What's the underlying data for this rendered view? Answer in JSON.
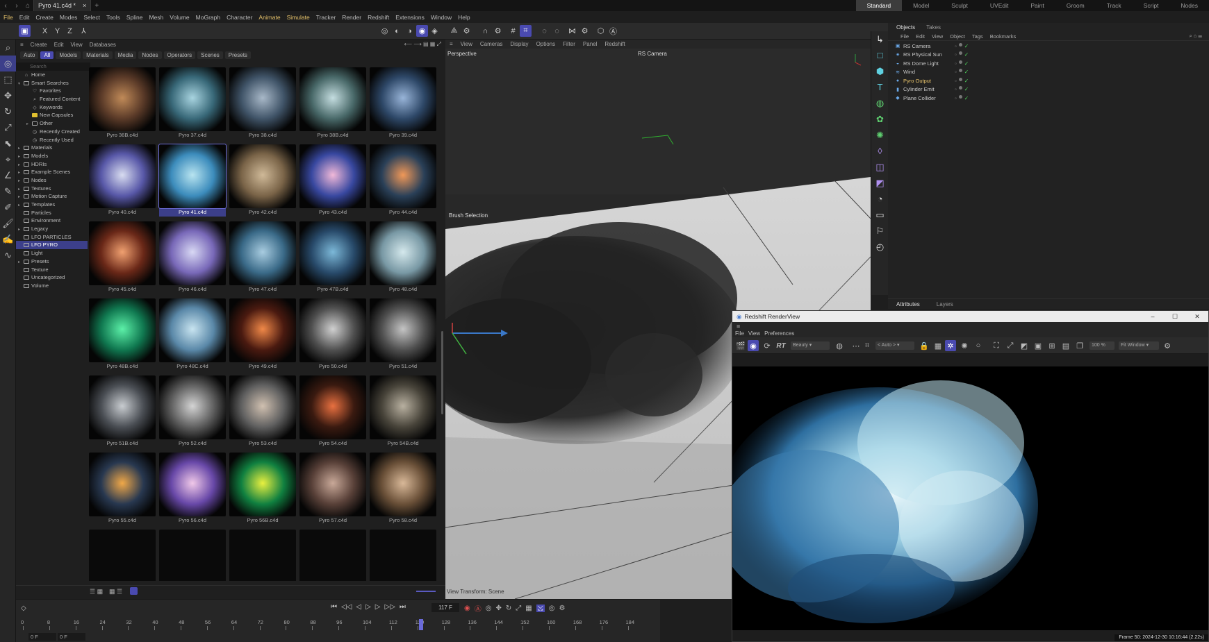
{
  "titlebar": {
    "doc_tab": "Pyro 41.c4d *",
    "close": "×",
    "add": "+",
    "layouts": [
      "Standard",
      "Model",
      "Sculpt",
      "UVEdit",
      "Paint",
      "Groom",
      "Track",
      "Script",
      "Nodes"
    ],
    "active_layout": "Standard"
  },
  "menubar": [
    "File",
    "Edit",
    "Create",
    "Modes",
    "Select",
    "Tools",
    "Spline",
    "Mesh",
    "Volume",
    "MoGraph",
    "Character",
    "Animate",
    "Simulate",
    "Tracker",
    "Render",
    "Redshift",
    "Extensions",
    "Window",
    "Help"
  ],
  "menubar_highlight": [
    "File",
    "Animate",
    "Simulate"
  ],
  "toolbar": {
    "axes": [
      "X",
      "Y",
      "Z"
    ]
  },
  "asset_browser": {
    "menu": [
      "Create",
      "Edit",
      "View",
      "Databases"
    ],
    "filters": [
      "Auto",
      "All",
      "Models",
      "Materials",
      "Media",
      "Nodes",
      "Operators",
      "Scenes",
      "Presets"
    ],
    "active_filter": "All",
    "search_placeholder": "Search",
    "tree": [
      {
        "label": "Home",
        "indent": 0,
        "type": "home"
      },
      {
        "label": "Smart Searches",
        "indent": 0,
        "type": "folder",
        "arrow": "down"
      },
      {
        "label": "Favorites",
        "indent": 1,
        "type": "heart"
      },
      {
        "label": "Featured Content",
        "indent": 1,
        "type": "search"
      },
      {
        "label": "Keywords",
        "indent": 1,
        "type": "tag"
      },
      {
        "label": "New Capsules",
        "indent": 1,
        "type": "yellow"
      },
      {
        "label": "Other",
        "indent": 1,
        "type": "folder",
        "arrow": "right"
      },
      {
        "label": "Recently Created",
        "indent": 1,
        "type": "clock"
      },
      {
        "label": "Recently Used",
        "indent": 1,
        "type": "clock"
      },
      {
        "label": "Materials",
        "indent": 0,
        "type": "folder",
        "arrow": "right"
      },
      {
        "label": "Models",
        "indent": 0,
        "type": "folder",
        "arrow": "right"
      },
      {
        "label": "HDRIs",
        "indent": 0,
        "type": "folder",
        "arrow": "right"
      },
      {
        "label": "Example Scenes",
        "indent": 0,
        "type": "folder",
        "arrow": "right"
      },
      {
        "label": "Nodes",
        "indent": 0,
        "type": "folder",
        "arrow": "right"
      },
      {
        "label": "Textures",
        "indent": 0,
        "type": "folder",
        "arrow": "right"
      },
      {
        "label": "Motion Capture",
        "indent": 0,
        "type": "folder",
        "arrow": "right"
      },
      {
        "label": "Templates",
        "indent": 0,
        "type": "folder",
        "arrow": "right"
      },
      {
        "label": "Particles",
        "indent": 0,
        "type": "folder"
      },
      {
        "label": "Environment",
        "indent": 0,
        "type": "folder"
      },
      {
        "label": "Legacy",
        "indent": 0,
        "type": "folder",
        "arrow": "right"
      },
      {
        "label": "LFO PARTICLES",
        "indent": 0,
        "type": "folder"
      },
      {
        "label": "LFO PYRO",
        "indent": 0,
        "type": "folder",
        "selected": true
      },
      {
        "label": "Light",
        "indent": 0,
        "type": "folder"
      },
      {
        "label": "Presets",
        "indent": 0,
        "type": "folder",
        "arrow": "right"
      },
      {
        "label": "Texture",
        "indent": 0,
        "type": "folder"
      },
      {
        "label": "Uncategorized",
        "indent": 0,
        "type": "folder"
      },
      {
        "label": "Volume",
        "indent": 0,
        "type": "folder"
      }
    ],
    "assets": [
      {
        "label": "Pyro 36B.c4d",
        "c1": "#c08a58",
        "c2": "#5a3a28"
      },
      {
        "label": "Pyro 37.c4d",
        "c1": "#a8d4e0",
        "c2": "#386878"
      },
      {
        "label": "Pyro 38.c4d",
        "c1": "#a8b8c8",
        "c2": "#405468"
      },
      {
        "label": "Pyro 38B.c4d",
        "c1": "#c4dde0",
        "c2": "#486868"
      },
      {
        "label": "Pyro 39.c4d",
        "c1": "#98b4d8",
        "c2": "#2e4868"
      },
      {
        "label": "Pyro 40.c4d",
        "c1": "#d8dcf0",
        "c2": "#5858a8"
      },
      {
        "label": "Pyro 41.c4d",
        "c1": "#b8e4f0",
        "c2": "#3c8cbc"
      },
      {
        "label": "Pyro 42.c4d",
        "c1": "#cfb998",
        "c2": "#7a6448"
      },
      {
        "label": "Pyro 43.c4d",
        "c1": "#f0b8d8",
        "c2": "#3848a0"
      },
      {
        "label": "Pyro 44.c4d",
        "c1": "#f09858",
        "c2": "#2a4058"
      },
      {
        "label": "Pyro 45.c4d",
        "c1": "#f0a070",
        "c2": "#6a2818"
      },
      {
        "label": "Pyro 46.c4d",
        "c1": "#d8d8f4",
        "c2": "#7868b8"
      },
      {
        "label": "Pyro 47.c4d",
        "c1": "#a8cce0",
        "c2": "#3a6a88"
      },
      {
        "label": "Pyro 47B.c4d",
        "c1": "#7cb8d8",
        "c2": "#284a6a"
      },
      {
        "label": "Pyro 48.c4d",
        "c1": "#d4e8ec",
        "c2": "#7898a4"
      },
      {
        "label": "Pyro 48B.c4d",
        "c1": "#5cf0a8",
        "c2": "#107850"
      },
      {
        "label": "Pyro 48C.c4d",
        "c1": "#c8e4f0",
        "c2": "#5a88a8"
      },
      {
        "label": "Pyro 49.c4d",
        "c1": "#f08848",
        "c2": "#4a1a10"
      },
      {
        "label": "Pyro 50.c4d",
        "c1": "#d0d0d0",
        "c2": "#505050"
      },
      {
        "label": "Pyro 51.c4d",
        "c1": "#c4c4c4",
        "c2": "#505050"
      },
      {
        "label": "Pyro 51B.c4d",
        "c1": "#c8ccd0",
        "c2": "#4a4e54"
      },
      {
        "label": "Pyro 52.c4d",
        "c1": "#d4d4d4",
        "c2": "#606060"
      },
      {
        "label": "Pyro 53.c4d",
        "c1": "#d0c0b0",
        "c2": "#606060"
      },
      {
        "label": "Pyro 54.c4d",
        "c1": "#e87040",
        "c2": "#3a1a10"
      },
      {
        "label": "Pyro 54B.c4d",
        "c1": "#b8b0a0",
        "c2": "#48443a"
      },
      {
        "label": "Pyro 55.c4d",
        "c1": "#f0a848",
        "c2": "#283850"
      },
      {
        "label": "Pyro 56.c4d",
        "c1": "#f0c8e8",
        "c2": "#6848a8"
      },
      {
        "label": "Pyro 56B.c4d",
        "c1": "#e8f040",
        "c2": "#108040"
      },
      {
        "label": "Pyro 57.c4d",
        "c1": "#c8a898",
        "c2": "#584038"
      },
      {
        "label": "Pyro 58.c4d",
        "c1": "#d8b898",
        "c2": "#6a5038"
      }
    ]
  },
  "viewport": {
    "menu": [
      "View",
      "Cameras",
      "Display",
      "Options",
      "Filter",
      "Panel",
      "Redshift"
    ],
    "label": "Perspective",
    "camera": "RS Camera",
    "brush_label": "Brush Selection",
    "bottom_label": "View Transform: Scene"
  },
  "timeline": {
    "frame_field": "117 F",
    "start_field": "0 F",
    "end_field": "0 F",
    "ticks": [
      "0",
      "8",
      "16",
      "24",
      "32",
      "40",
      "48",
      "56",
      "64",
      "72",
      "80",
      "88",
      "96",
      "104",
      "112",
      "120",
      "128",
      "136",
      "144",
      "152",
      "160",
      "168",
      "176",
      "184"
    ],
    "playhead_label": "117",
    "frame_fraction": 0.635
  },
  "object_manager": {
    "tabs": [
      "Objects",
      "Takes"
    ],
    "active_tab": "Objects",
    "menu": [
      "File",
      "Edit",
      "View",
      "Object",
      "Tags",
      "Bookmarks"
    ],
    "objects": [
      {
        "name": "RS Camera",
        "icon": "camera-icon",
        "glyph": "▣",
        "color": "#c8c8c8"
      },
      {
        "name": "RS Physical Sun",
        "icon": "sun-icon",
        "glyph": "✷",
        "color": "#c8c8c8"
      },
      {
        "name": "RS Dome Light",
        "icon": "dome-icon",
        "glyph": "◒",
        "color": "#c8c8c8"
      },
      {
        "name": "Wind",
        "icon": "wind-icon",
        "glyph": "≋",
        "color": "#c8c8c8"
      },
      {
        "name": "Pyro Output",
        "icon": "pyro-output-icon",
        "glyph": "●",
        "color": "#e6c26a"
      },
      {
        "name": "Cylinder Emit",
        "icon": "cylinder-icon",
        "glyph": "▮",
        "color": "#c8c8c8"
      },
      {
        "name": "Plane Collider",
        "icon": "plane-icon",
        "glyph": "◆",
        "color": "#c8c8c8"
      }
    ],
    "attr_tabs": [
      "Attributes",
      "Layers"
    ],
    "active_attr_tab": "Attributes"
  },
  "render_view": {
    "title": "Redshift RenderView",
    "menu": [
      "File",
      "View",
      "Preferences"
    ],
    "aov": "Beauty",
    "auto": "< Auto >",
    "zoom": "100 %",
    "fit": "Fit Window",
    "status": "Frame  50:  2024-12-30  10:16:44  (2.22s)",
    "rt_label": "RT"
  }
}
